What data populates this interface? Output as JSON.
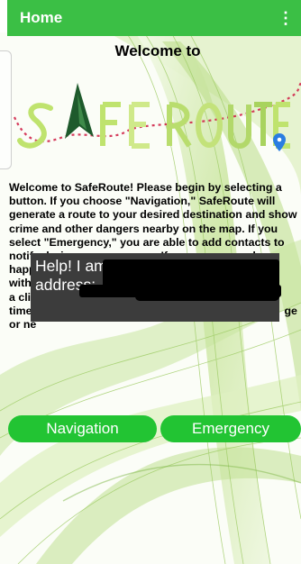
{
  "app_bar": {
    "title": "Home",
    "menu_icon": "overflow-menu-icon"
  },
  "welcome_heading": "Welcome to",
  "logo": {
    "text": "SafeRoute",
    "pin_icon": "map-pin-icon"
  },
  "intro": {
    "visible_start": "Welcome to SafeRoute! Please begin by selecting a button. If you choose \"Navigation,\" SafeRoute will generate a route to your desired destination and show crime and other dangers nearby on the map. If you select \"Emergency,\" you are able to add contacts to",
    "partial_line_1": "notify during an emergency. If an emergency does",
    "partial_line_2_start": "happ",
    "partial_line_2_end": "with",
    "partial_line_3_start": "a cli",
    "partial_line_4_start": "time",
    "partial_line_4_end": "ge",
    "partial_line_5_start": "or ne"
  },
  "toast": {
    "line1": "Help! I am in danger. Here is my",
    "line2_prefix": "address:"
  },
  "buttons": {
    "navigation": "Navigation",
    "emergency": "Emergency"
  },
  "colors": {
    "app_bar": "#3bbf45",
    "button": "#22c433",
    "toast_bg": "#3c3c3c",
    "logo_dark_green": "#1e5a2c",
    "logo_light_green": "#bfe36e",
    "logo_red_dots": "#d0264a",
    "pin": "#2a7de1"
  }
}
